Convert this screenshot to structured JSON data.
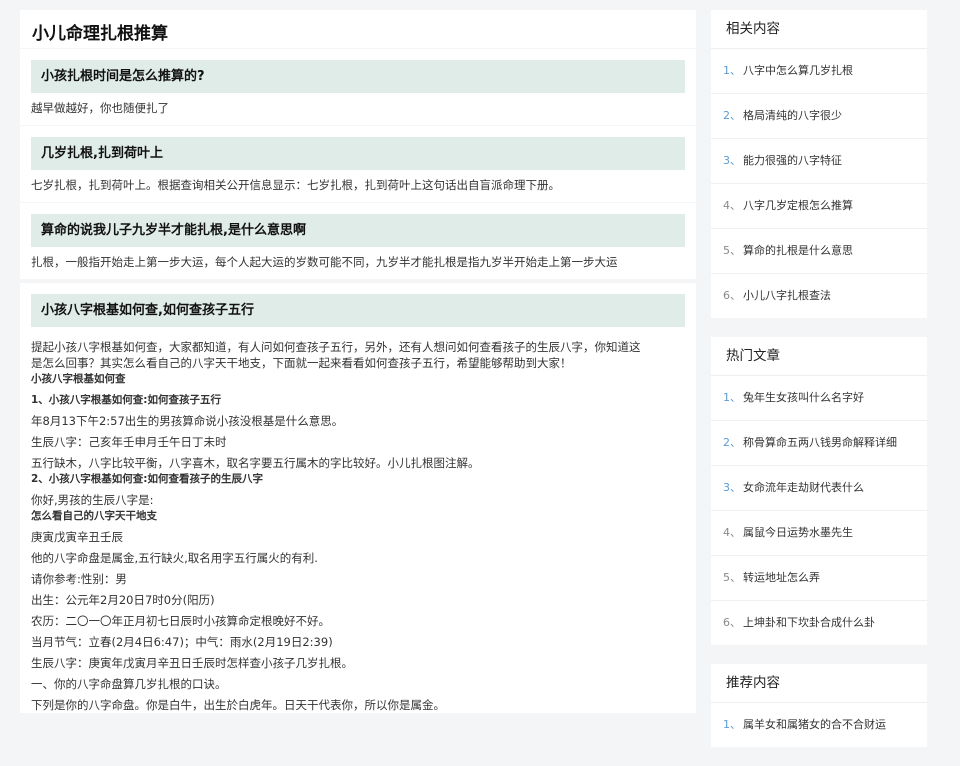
{
  "main": {
    "title": "小儿命理扎根推算",
    "qa": [
      {
        "q": "小孩扎根时间是怎么推算的?",
        "a": "越早做越好，你也随便扎了"
      },
      {
        "q": "几岁扎根,扎到荷叶上",
        "a": "七岁扎根，扎到荷叶上。根据查询相关公开信息显示：七岁扎根，扎到荷叶上这句话出自盲派命理下册。"
      },
      {
        "q": "算命的说我儿子九岁半才能扎根,是什么意思啊",
        "a": "扎根，一般指开始走上第一步大运，每个人起大运的岁数可能不同，九岁半才能扎根是指九岁半开始走上第一步大运"
      }
    ],
    "article": {
      "heading": "小孩八字根基如何查,如何查孩子五行",
      "intro_1": "提起小孩八字根基如何查，大家都知道，有人问如何查孩子五行，另外，还有人想问如何查看孩子的生辰八字，你知道这",
      "intro_2": "是怎么回事？其实怎么看自己的八字天干地支，下面就一起来看看如何查孩子五行，希望能够帮助到大家！",
      "sub_1": "小孩八字根基如何查",
      "sub_2": "1、小孩八字根基如何查:如何查孩子五行",
      "p_1": "年8月13下午2:57出生的男孩算命说小孩没根基是什么意思。",
      "p_2": "生辰八字：己亥年壬申月壬午日丁未时",
      "p_3": "五行缺木，八字比较平衡，八字喜木，取名字要五行属木的字比较好。小儿扎根图注解。",
      "sub_3": "2、小孩八字根基如何查:如何查看孩子的生辰八字",
      "p_4": "你好,男孩的生辰八字是:",
      "sub_4": "怎么看自己的八字天干地支",
      "p_5": "庚寅戊寅辛丑壬辰",
      "p_6": "他的八字命盘是属金,五行缺火,取名用字五行属火的有利.",
      "p_7": "请你参考:性别：男",
      "p_8": "出生：公元年2月20日7时0分(阳历)",
      "p_9": "农历：二〇一〇年正月初七日辰时小孩算命定根晚好不好。",
      "p_10": "当月节气：立春(2月4日6:47)；中气：雨水(2月19日2:39)",
      "p_11": "生辰八字：庚寅年戊寅月辛丑日壬辰时怎样查小孩子几岁扎根。",
      "p_12": "一、你的八字命盘算几岁扎根的口诀。",
      "p_13": "下列是你的八字命盘。你是白牛，出生於白虎年。日天干代表你，所以你是属金。"
    }
  },
  "sidebar": {
    "related": {
      "title": "相关内容",
      "items": [
        {
          "num": "1、",
          "label": "八字中怎么算几岁扎根"
        },
        {
          "num": "2、",
          "label": "格局清纯的八字很少"
        },
        {
          "num": "3、",
          "label": "能力很强的八字特征"
        },
        {
          "num": "4、",
          "label": "八字几岁定根怎么推算"
        },
        {
          "num": "5、",
          "label": "算命的扎根是什么意思"
        },
        {
          "num": "6、",
          "label": "小儿八字扎根查法"
        }
      ]
    },
    "hot": {
      "title": "热门文章",
      "items": [
        {
          "num": "1、",
          "label": "兔年生女孩叫什么名字好"
        },
        {
          "num": "2、",
          "label": "称骨算命五两八钱男命解释详细"
        },
        {
          "num": "3、",
          "label": "女命流年走劫财代表什么"
        },
        {
          "num": "4、",
          "label": "属鼠今日运势水墨先生"
        },
        {
          "num": "5、",
          "label": "转运地址怎么弄"
        },
        {
          "num": "6、",
          "label": "上坤卦和下坎卦合成什么卦"
        }
      ]
    },
    "recommend": {
      "title": "推荐内容",
      "items": [
        {
          "num": "1、",
          "label": "属羊女和属猪女的合不合财运"
        }
      ]
    }
  }
}
